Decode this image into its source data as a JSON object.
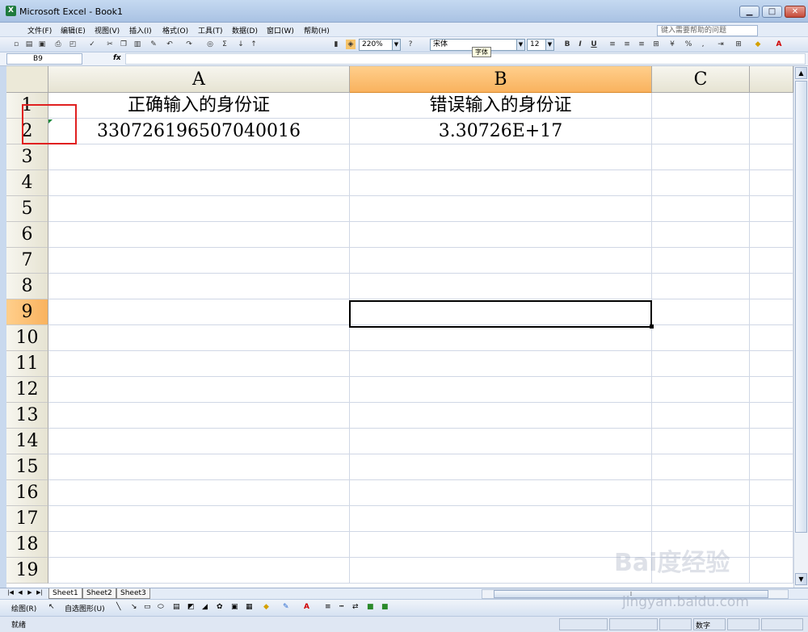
{
  "window": {
    "title": "Microsoft Excel - Book1",
    "min": "▁",
    "max": "□",
    "close": "✕",
    "app_icon": "X"
  },
  "menu": {
    "items": [
      "文件(F)",
      "编辑(E)",
      "视图(V)",
      "插入(I)",
      "格式(O)",
      "工具(T)",
      "数据(D)",
      "窗口(W)",
      "帮助(H)"
    ],
    "help_placeholder": "键入需要帮助的问题"
  },
  "toolbar": {
    "zoom": "220%",
    "font": "宋体",
    "font_size": "12",
    "bold": "B",
    "italic": "I",
    "underline": "U",
    "percent": "%",
    "tooltip": "字体"
  },
  "formula_bar": {
    "name_box": "B9",
    "fx": "fx",
    "content": ""
  },
  "columns": [
    "A",
    "B",
    "C"
  ],
  "rows": [
    "1",
    "2",
    "3",
    "4",
    "5",
    "6",
    "7",
    "8",
    "9",
    "10",
    "11",
    "12",
    "13",
    "14",
    "15",
    "16",
    "17",
    "18",
    "19"
  ],
  "cells": {
    "A1": "正确输入的身份证",
    "B1": "错误输入的身份证",
    "A2": "330726196507040016",
    "B2": "3.30726E+17"
  },
  "selected_cell": "B9",
  "sheet_tabs": [
    "Sheet1",
    "Sheet2",
    "Sheet3"
  ],
  "draw_toolbar": {
    "draw": "绘图(R)",
    "autoshapes": "自选图形(U)"
  },
  "status": {
    "ready": "就绪",
    "numlock": "数字"
  },
  "watermark": {
    "main": "Bai度经验",
    "url": "jingyan.baidu.com"
  }
}
